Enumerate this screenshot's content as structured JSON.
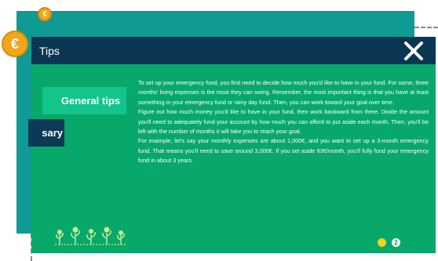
{
  "modal": {
    "title": "Tips",
    "close_icon": "close-icon"
  },
  "tabs": [
    {
      "label": "General tips",
      "active": true
    },
    {
      "label": "sary",
      "active": false
    }
  ],
  "content": {
    "paragraphs": [
      "To set up your emergency fund, you first need to decide how much you'd like to have in your fund. For some, three months' living expenses is the most they can swing. Remember, the most important thing is that you have at least something in your emergency fund or rainy day fund. Then, you can work toward your goal over time.",
      "Figure out how much money you'd like to have in your fund, then work backward from there. Divide the amount you'll need to adequately fund your account by how much you can afford to put aside each month. Then, you'll be left with the number of months it will take you to reach your goal.",
      "For example, let's say your monthly expenses are about 1,000€, and you want to set up a 3-month emergency fund. That means you'll need to save around 3,000€. If you set aside 83€/month, you'll fully fund your emergency fund in about 3 years."
    ]
  },
  "pager": {
    "pages": [
      "1",
      "2"
    ],
    "current": "1"
  },
  "decor": {
    "coin_symbol": "€",
    "coin_icon": "coin-icon",
    "plant_icon": "money-plant-icon"
  },
  "colors": {
    "background_card": "#0f9a93",
    "modal_bg": "#08a86a",
    "titlebar": "#0b3653",
    "active_tab": "#12c58a",
    "inactive_tab": "#0b3a57",
    "coin": "#f3a51c",
    "active_dot": "#f3d21a"
  }
}
